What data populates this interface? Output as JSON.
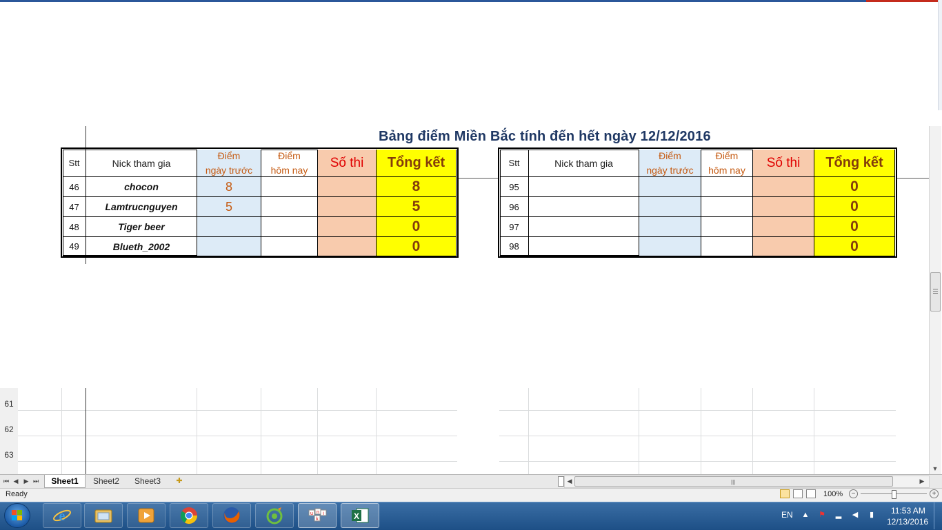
{
  "sheet": {
    "title": "Bảng điểm Miền Bắc tính đến hết ngày 12/12/2016",
    "row_numbers": [
      "61",
      "62",
      "63"
    ],
    "headers": {
      "stt": "Stt",
      "nick": "Nick tham gia",
      "prev_line1": "Điểm",
      "prev_line2": "ngày trước",
      "today_line1": "Điểm",
      "today_line2": "hôm nay",
      "sothi": "Số thi",
      "total": "Tổng kết"
    },
    "left_table": {
      "rows": [
        {
          "stt": "46",
          "nick": "chocon",
          "prev": "8",
          "today": "",
          "sothi": "",
          "total": "8"
        },
        {
          "stt": "47",
          "nick": "Lamtrucnguyen",
          "prev": "5",
          "today": "",
          "sothi": "",
          "total": "5"
        },
        {
          "stt": "48",
          "nick": "Tiger beer",
          "prev": "",
          "today": "",
          "sothi": "",
          "total": "0"
        },
        {
          "stt": "49",
          "nick": "Blueth_2002",
          "prev": "",
          "today": "",
          "sothi": "",
          "total": "0"
        }
      ]
    },
    "right_table": {
      "rows": [
        {
          "stt": "95",
          "nick": "",
          "prev": "",
          "today": "",
          "sothi": "",
          "total": "0"
        },
        {
          "stt": "96",
          "nick": "",
          "prev": "",
          "today": "",
          "sothi": "",
          "total": "0"
        },
        {
          "stt": "97",
          "nick": "",
          "prev": "",
          "today": "",
          "sothi": "",
          "total": "0"
        },
        {
          "stt": "98",
          "nick": "",
          "prev": "",
          "today": "",
          "sothi": "",
          "total": "0"
        }
      ]
    }
  },
  "tabs": {
    "sheet1": "Sheet1",
    "sheet2": "Sheet2",
    "sheet3": "Sheet3"
  },
  "status": {
    "ready": "Ready",
    "zoom": "100%",
    "zoom_minus": "−",
    "zoom_plus": "+"
  },
  "taskbar": {
    "language": "EN",
    "time": "11:53 AM",
    "date": "12/13/2016",
    "apps": [
      "windows-explorer",
      "internet-explorer",
      "file-explorer",
      "media-player",
      "chrome",
      "firefox",
      "coccoc",
      "unikey",
      "excel"
    ]
  },
  "colors": {
    "title": "#1f3864",
    "prev_fill": "#ddebf7",
    "sothi_fill": "#f8cbad",
    "total_fill": "#ffff00",
    "sothi_text": "#e00000",
    "total_text": "#833c0b",
    "score_text": "#c55a11"
  }
}
